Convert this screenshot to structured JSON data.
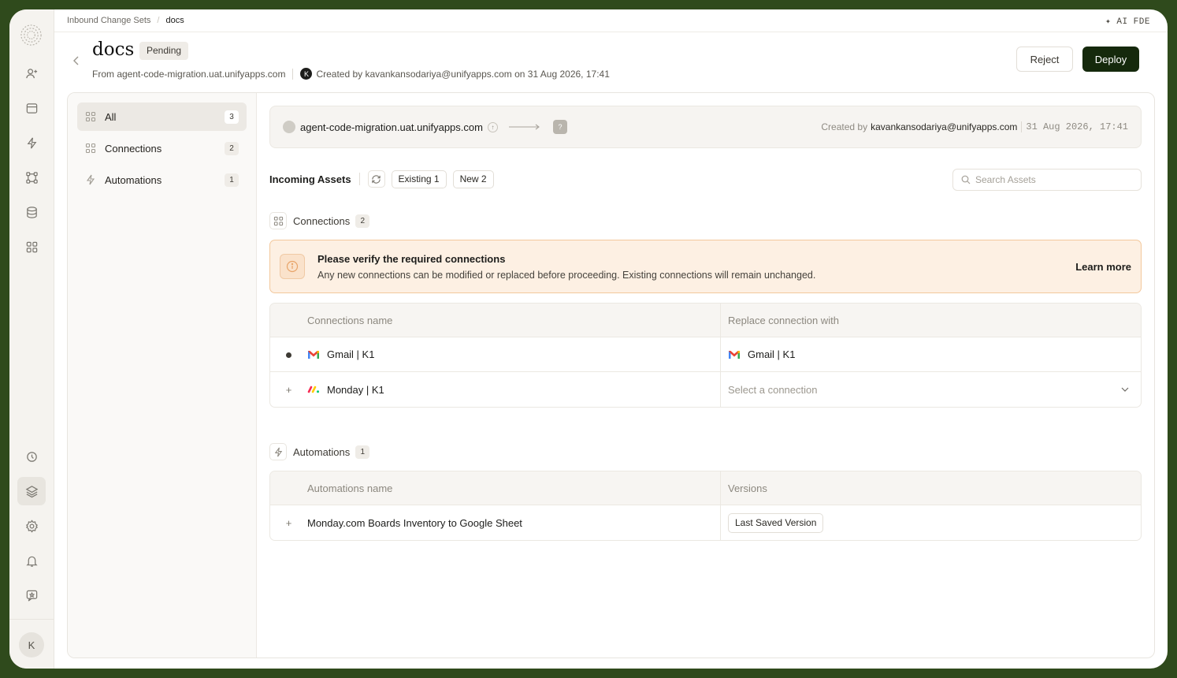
{
  "breadcrumb": {
    "parent": "Inbound Change Sets",
    "current": "docs"
  },
  "ai_fde": "✦ AI FDE",
  "header": {
    "title": "docs",
    "status": "Pending",
    "from": "From agent-code-migration.uat.unifyapps.com",
    "avatar_letter": "K",
    "created": "Created by kavankansodariya@unifyapps.com on 31 Aug 2026, 17:41",
    "reject_label": "Reject",
    "deploy_label": "Deploy"
  },
  "rail": {
    "avatar_letter": "K"
  },
  "leftnav": {
    "items": [
      {
        "label": "All",
        "count": "3"
      },
      {
        "label": "Connections",
        "count": "2"
      },
      {
        "label": "Automations",
        "count": "1"
      }
    ]
  },
  "source": {
    "host": "agent-code-migration.uat.unifyapps.com",
    "target_icon": "?",
    "created_by_label": "Created by",
    "created_by": "kavankansodariya@unifyapps.com",
    "datetime": "31 Aug 2026, 17:41"
  },
  "assets": {
    "label": "Incoming Assets",
    "existing": "Existing 1",
    "new": "New 2",
    "search_placeholder": "Search Assets"
  },
  "connections": {
    "label": "Connections",
    "count": "2",
    "alert_title": "Please verify the required connections",
    "alert_body": "Any new connections can be modified or replaced before proceeding. Existing connections will remain unchanged.",
    "learn_more": "Learn more",
    "col_name": "Connections name",
    "col_replace": "Replace connection with",
    "rows": [
      {
        "marker": "●",
        "name": "Gmail | K1",
        "replace": "Gmail | K1"
      },
      {
        "marker": "+",
        "name": "Monday | K1",
        "replace": "Select a connection"
      }
    ]
  },
  "automations": {
    "label": "Automations",
    "count": "1",
    "col_name": "Automations name",
    "col_versions": "Versions",
    "rows": [
      {
        "marker": "+",
        "name": "Monday.com Boards Inventory to Google Sheet",
        "version": "Last Saved Version"
      }
    ]
  },
  "colors": {
    "deploy": "#15290c",
    "alert_bg": "#fdf0e3",
    "alert_border": "#f3c89c",
    "frame_bg": "#2f4a1c"
  }
}
